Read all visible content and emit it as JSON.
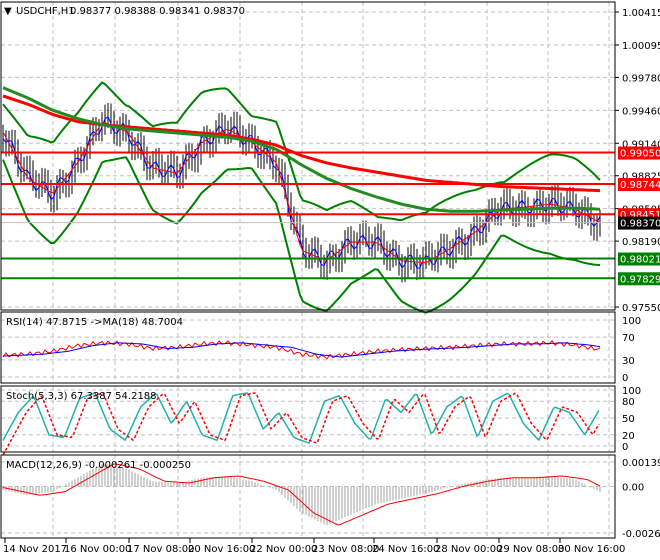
{
  "header": {
    "symbol": "USDCHF,H1",
    "ohlc": "0.98377 0.98388 0.98341 0.98370"
  },
  "chart_data": [
    {
      "type": "line",
      "name": "price",
      "title": "USDCHF,H1",
      "ylim": [
        0.9755,
        1.00415
      ],
      "ticks": [
        "1.00415",
        "1.00095",
        "0.99780",
        "0.99460",
        "0.99140",
        "0.98825",
        "0.98505",
        "0.98190",
        "0.97550"
      ],
      "x_ticks": [
        "14 Nov 2017",
        "16 Nov 00:00",
        "17 Nov 08:00",
        "20 Nov 16:00",
        "22 Nov 00:00",
        "23 Nov 08:00",
        "24 Nov 16:00",
        "28 Nov 00:00",
        "29 Nov 08:00",
        "30 Nov 16:00"
      ],
      "close": [
        0.9925,
        0.988,
        0.9865,
        0.9895,
        0.9935,
        0.9925,
        0.989,
        0.9885,
        0.9915,
        0.9928,
        0.9915,
        0.9895,
        0.981,
        0.98,
        0.9818,
        0.9818,
        0.98,
        0.9798,
        0.9812,
        0.9828,
        0.985,
        0.9852,
        0.9855,
        0.985,
        0.9837
      ],
      "ma_red": [
        0.996,
        0.9952,
        0.9942,
        0.9935,
        0.9932,
        0.993,
        0.9928,
        0.9926,
        0.9924,
        0.9922,
        0.9918,
        0.9912,
        0.9902,
        0.9895,
        0.989,
        0.9886,
        0.9882,
        0.9878,
        0.9876,
        0.9874,
        0.9872,
        0.9871,
        0.987,
        0.9869,
        0.9868
      ],
      "ma_green": [
        0.9968,
        0.9958,
        0.9946,
        0.9938,
        0.9932,
        0.9928,
        0.9926,
        0.9924,
        0.9922,
        0.992,
        0.9916,
        0.9908,
        0.9893,
        0.988,
        0.987,
        0.9862,
        0.9855,
        0.985,
        0.9848,
        0.9848,
        0.9849,
        0.985,
        0.9851,
        0.9851,
        0.985
      ],
      "levels": [
        {
          "value": "0.99050",
          "color": "#ff0000"
        },
        {
          "value": "0.98744",
          "color": "#ff0000"
        },
        {
          "value": "0.98451",
          "color": "#ff0000"
        },
        {
          "value": "0.98021",
          "color": "#008000"
        },
        {
          "value": "0.97829",
          "color": "#008000"
        }
      ],
      "current": "0.98370"
    },
    {
      "type": "line",
      "title": "RSI(14) 47.8715  ->MA(18) 48.7004",
      "ylim": [
        0,
        100
      ],
      "ticks": [
        "100",
        "70",
        "30",
        "0"
      ],
      "rsi": [
        38,
        40,
        45,
        55,
        60,
        58,
        50,
        52,
        58,
        60,
        56,
        52,
        40,
        35,
        40,
        45,
        48,
        50,
        52,
        55,
        58,
        58,
        60,
        56,
        48
      ]
    },
    {
      "type": "line",
      "title": "Stoch(5,3,3) 67.3387 54.2188",
      "ylim": [
        0,
        100
      ],
      "ticks": [
        "100",
        "80",
        "50",
        "20",
        "0"
      ],
      "k": [
        10,
        60,
        90,
        20,
        15,
        85,
        95,
        30,
        10,
        70,
        95,
        40,
        80,
        20,
        10,
        90,
        95,
        30,
        60,
        15,
        5,
        80,
        90,
        40,
        10,
        85,
        60,
        95,
        20,
        70,
        90,
        15,
        80,
        95,
        40,
        10,
        70,
        60,
        20,
        67
      ]
    },
    {
      "type": "line",
      "title": "MACD(12,26,9) -0.000261 -0.000250",
      "ylim": [
        -0.002641,
        0.001393
      ],
      "ticks": [
        "0.001393",
        "0.00",
        "-0.002641"
      ],
      "macd": [
        -0.0002,
        -0.0005,
        -0.0003,
        0.0005,
        0.0013,
        0.001,
        0.0003,
        0.0002,
        0.0005,
        0.0006,
        0.0003,
        -0.0002,
        -0.0015,
        -0.0022,
        -0.0016,
        -0.001,
        -0.0007,
        -0.0004,
        0.0,
        0.0003,
        0.0005,
        0.0005,
        0.0006,
        0.0004,
        -0.0003
      ]
    }
  ]
}
